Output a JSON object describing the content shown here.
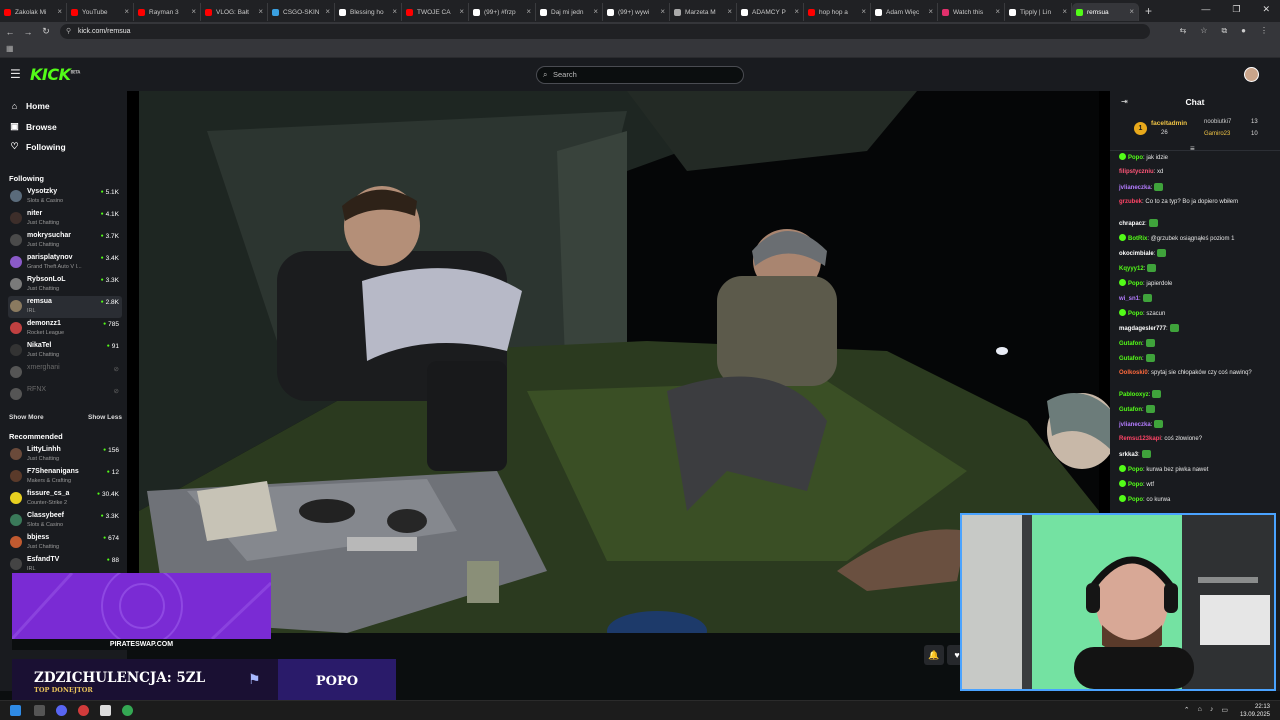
{
  "browser": {
    "tabs": [
      {
        "label": "Zakolak Mi",
        "color": "#ff0000"
      },
      {
        "label": "YouTube",
        "color": "#ff0000"
      },
      {
        "label": "Rayman 3",
        "color": "#ff0000"
      },
      {
        "label": "VLOG: Bałt",
        "color": "#ff0000"
      },
      {
        "label": "CSGO-SKIN",
        "color": "#3aa0e0"
      },
      {
        "label": "Blessing ho",
        "color": "#ffffff"
      },
      {
        "label": "TWOJE CA",
        "color": "#ff0000"
      },
      {
        "label": "(99+) #frzp",
        "color": "#ffffff"
      },
      {
        "label": "Daj mi jedn",
        "color": "#ffffff"
      },
      {
        "label": "(99+) wywi",
        "color": "#ffffff"
      },
      {
        "label": "Marzeta M",
        "color": "#aaaaaa"
      },
      {
        "label": "ADAMCY P",
        "color": "#ffffff"
      },
      {
        "label": "hop hop a",
        "color": "#ff0000"
      },
      {
        "label": "Adam Więc",
        "color": "#ffffff"
      },
      {
        "label": "Watch this",
        "color": "#e1306c"
      },
      {
        "label": "Tipply | Lin",
        "color": "#ffffff"
      },
      {
        "label": "remsua",
        "color": "#53fc18"
      }
    ],
    "new_tab": "+",
    "url": "kick.com/remsua"
  },
  "header": {
    "logo": "KICK",
    "logo_tag": "BETA",
    "search_placeholder": "Search"
  },
  "sidebar": {
    "nav": [
      {
        "label": "Home",
        "icon": "home-icon"
      },
      {
        "label": "Browse",
        "icon": "browse-icon"
      },
      {
        "label": "Following",
        "icon": "heart-icon"
      }
    ],
    "following_title": "Following",
    "following": [
      {
        "name": "Vysotzky",
        "category": "Slots & Casino",
        "viewers": "5.1K",
        "color": "#5a6b7b"
      },
      {
        "name": "niter",
        "category": "Just Chatting",
        "viewers": "4.1K",
        "color": "#3d2e2a"
      },
      {
        "name": "mokrysuchar",
        "category": "Just Chatting",
        "viewers": "3.7K",
        "color": "#4a4a4a"
      },
      {
        "name": "parisplatynov",
        "category": "Grand Theft Auto V I...",
        "viewers": "3.4K",
        "color": "#8a5ac8"
      },
      {
        "name": "RybsonLoL",
        "category": "Just Chatting",
        "viewers": "3.3K",
        "color": "#7a7a7a"
      },
      {
        "name": "remsua",
        "category": "IRL",
        "viewers": "2.8K",
        "color": "#8a7a60"
      },
      {
        "name": "demonzz1",
        "category": "Rocket League",
        "viewers": "785",
        "color": "#c04040"
      },
      {
        "name": "NikaTel",
        "category": "Just Chatting",
        "viewers": "91",
        "color": "#333333"
      },
      {
        "name": "xmerghani",
        "category": "",
        "viewers": "",
        "color": "#555555",
        "offline": true
      },
      {
        "name": "RFNX",
        "category": "",
        "viewers": "",
        "color": "#555555",
        "offline": true
      }
    ],
    "show_more": "Show More",
    "show_less": "Show Less",
    "recommended_title": "Recommended",
    "recommended": [
      {
        "name": "LittyLinhh",
        "category": "Just Chatting",
        "viewers": "156",
        "color": "#6a4a3a"
      },
      {
        "name": "F7Shenanigans",
        "category": "Makers & Crafting",
        "viewers": "12",
        "color": "#5a3a2a"
      },
      {
        "name": "fissure_cs_a",
        "category": "Counter-Strike 2",
        "viewers": "30.4K",
        "color": "#e8d020"
      },
      {
        "name": "Classybeef",
        "category": "Slots & Casino",
        "viewers": "3.3K",
        "color": "#3a7a5a"
      },
      {
        "name": "bbjess",
        "category": "Just Chatting",
        "viewers": "674",
        "color": "#c05a30"
      },
      {
        "name": "EsfandTV",
        "category": "IRL",
        "viewers": "88",
        "color": "#444444"
      }
    ]
  },
  "chat": {
    "title": "Chat",
    "leaderboard": [
      {
        "rank": "1",
        "name": "faceltadmin",
        "count": "26"
      },
      {
        "name": "noobiutki7",
        "count": "13"
      },
      {
        "name": "Gamiro23",
        "count": "10"
      }
    ],
    "messages": [
      {
        "user": "Popo",
        "color": "#53fc18",
        "text": " jak idzie",
        "badge": true
      },
      {
        "user": "filipstyczniu",
        "color": "#ff5577",
        "text": " xd",
        "badge": false
      },
      {
        "user": "jvlianeczka",
        "color": "#b47cff",
        "text": "",
        "emote": true
      },
      {
        "user": "grzubek",
        "color": "#ff4466",
        "text": " Co to za typ? Bo ja dopiero wbiłem"
      },
      {
        "user": "chrapacz",
        "color": "#ffffff",
        "text": "",
        "emote": true
      },
      {
        "user": "BotRix",
        "color": "#53fc18",
        "text": " @grzubek osiągnąłeś poziom 1",
        "badge": true
      },
      {
        "user": "okocimbiale",
        "color": "#ffffff",
        "text": "",
        "emote": true
      },
      {
        "user": "Kqyyy12",
        "color": "#53fc18",
        "text": "",
        "emote": true
      },
      {
        "user": "Popo",
        "color": "#53fc18",
        "text": " japierdole",
        "badge": true
      },
      {
        "user": "wi_sn1",
        "color": "#b47cff",
        "text": "",
        "emote": true
      },
      {
        "user": "Popo",
        "color": "#53fc18",
        "text": " szacun",
        "badge": true
      },
      {
        "user": "magdagesler777",
        "color": "#ffffff",
        "text": "",
        "emote": true
      },
      {
        "user": "Gutafon",
        "color": "#53fc18",
        "text": "",
        "emote": true
      },
      {
        "user": "Gutafon",
        "color": "#53fc18",
        "text": "",
        "emote": true
      },
      {
        "user": "Oolkoski0",
        "color": "#ff6a3d",
        "text": " spytaj sie chłopaków czy coś nawinq?"
      },
      {
        "user": "Pablooxyz",
        "color": "#53fc18",
        "text": "",
        "emote": true
      },
      {
        "user": "Gutafon",
        "color": "#53fc18",
        "text": "",
        "emote": true
      },
      {
        "user": "jvlianeczka",
        "color": "#b47cff",
        "text": "",
        "emote": true
      },
      {
        "user": "Remsu123kapi",
        "color": "#ff4466",
        "text": " coś złowione?"
      },
      {
        "user": "srkka3",
        "color": "#ffffff",
        "text": "",
        "emote": true
      },
      {
        "user": "Popo",
        "color": "#53fc18",
        "text": " kurwa bez piwka nawet",
        "badge": true
      },
      {
        "user": "Popo",
        "color": "#53fc18",
        "text": " wtf",
        "badge": true
      },
      {
        "user": "Popo",
        "color": "#53fc18",
        "text": " co kurwa",
        "badge": true
      }
    ]
  },
  "donation": {
    "site": "PIRATESWAP.COM",
    "amount": "ZDZICHULENCJA: 5ZL",
    "subtitle": "TOP DONEJTOR",
    "donor": "POPO"
  },
  "taskbar": {
    "time": "22:13",
    "date": "13.09.2025"
  }
}
